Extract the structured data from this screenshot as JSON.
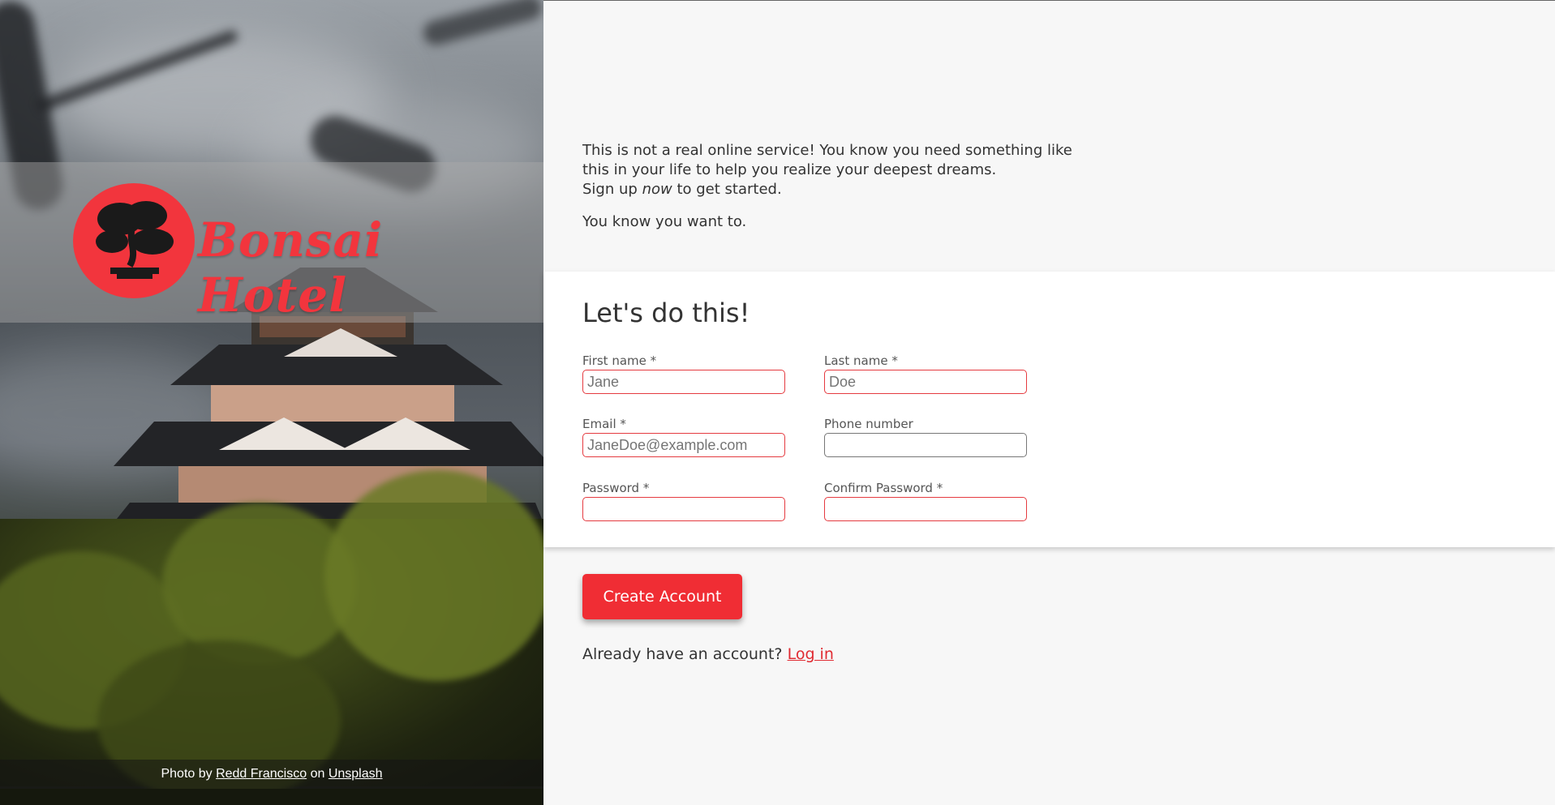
{
  "brand": {
    "name": "Bonsai Hotel",
    "accent": "#f02d34"
  },
  "credit": {
    "prefix": "Photo by",
    "photographer": "Redd Francisco",
    "on": "on",
    "site": "Unsplash"
  },
  "intro": {
    "line1": "This is not a real online service! You know you need something like this in your life to help you realize your deepest dreams.",
    "signup_pre": "Sign up",
    "signup_em": "now",
    "signup_post": "to get started.",
    "line2": "You know you want to."
  },
  "form": {
    "title": "Let's do this!",
    "first_name": {
      "label": "First name *",
      "placeholder": "Jane"
    },
    "last_name": {
      "label": "Last name *",
      "placeholder": "Doe"
    },
    "email": {
      "label": "Email *",
      "placeholder": "JaneDoe@example.com"
    },
    "phone": {
      "label": "Phone number",
      "placeholder": ""
    },
    "password": {
      "label": "Password *",
      "placeholder": ""
    },
    "confirm_password": {
      "label": "Confirm Password *",
      "placeholder": ""
    }
  },
  "actions": {
    "create_label": "Create Account",
    "login_prompt": "Already have an account?",
    "login_link": "Log in"
  }
}
